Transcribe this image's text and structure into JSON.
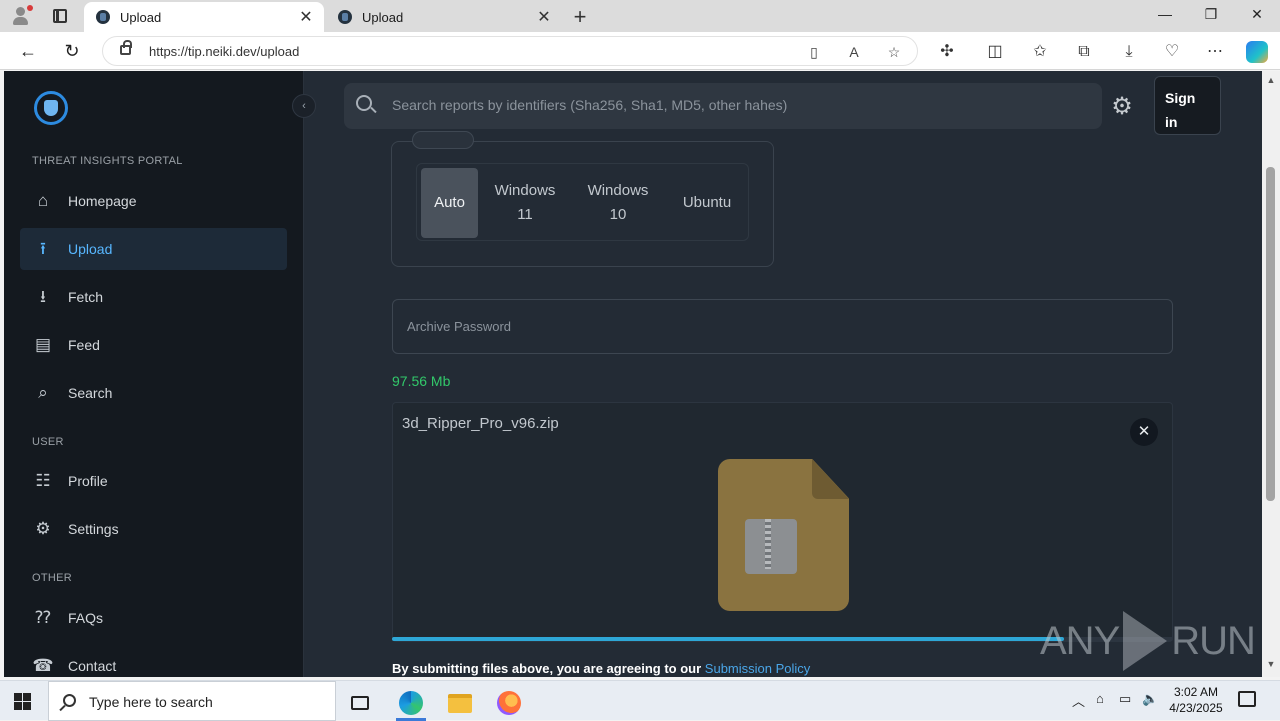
{
  "browser": {
    "tabs": [
      {
        "label": "Upload",
        "active": true
      },
      {
        "label": "Upload",
        "active": false
      }
    ],
    "url": "https://tip.neiki.dev/upload"
  },
  "sidebar": {
    "sections": {
      "portal": "THREAT INSIGHTS PORTAL",
      "user": "USER",
      "other": "OTHER"
    },
    "items": [
      {
        "label": "Homepage",
        "icon": "home-icon"
      },
      {
        "label": "Upload",
        "icon": "upload-icon",
        "active": true
      },
      {
        "label": "Fetch",
        "icon": "download-icon"
      },
      {
        "label": "Feed",
        "icon": "feed-icon"
      },
      {
        "label": "Search",
        "icon": "search-icon"
      },
      {
        "label": "Profile",
        "icon": "profile-icon"
      },
      {
        "label": "Settings",
        "icon": "gear-icon"
      },
      {
        "label": "FAQs",
        "icon": "faq-icon"
      },
      {
        "label": "Contact",
        "icon": "contact-icon"
      }
    ]
  },
  "topbar": {
    "search_placeholder": "Search reports by identifiers (Sha256, Sha1, MD5, other hahes)",
    "signin_label": "Sign in"
  },
  "os_selector": {
    "options": [
      "Auto",
      "Windows 11",
      "Windows 10",
      "Ubuntu"
    ],
    "selected": "Auto"
  },
  "upload": {
    "password_placeholder": "Archive Password",
    "file_size": "97.56 Mb",
    "file_name": "3d_Ripper_Pro_v96.zip",
    "progress_fraction": 0.86,
    "policy_text": "By submitting files above, you are agreeing to our",
    "policy_link": "Submission Policy"
  },
  "watermark": {
    "left": "ANY",
    "right": "RUN"
  },
  "taskbar": {
    "search_placeholder": "Type here to search",
    "time": "3:02 AM",
    "date": "4/23/2025"
  },
  "colors": {
    "accent": "#58b7ff",
    "size_text": "#32c86a",
    "progress": "#2ea7d6",
    "page_bg": "#232b35",
    "sidebar_bg": "#14191f"
  }
}
